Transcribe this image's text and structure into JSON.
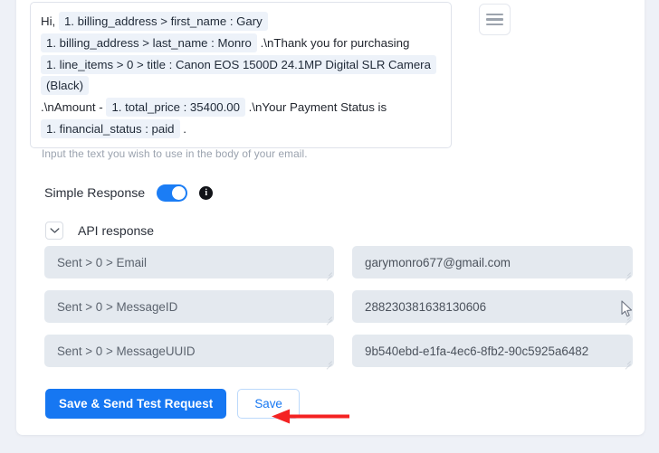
{
  "editor": {
    "lines": [
      [
        {
          "type": "text",
          "value": "Hi, "
        },
        {
          "type": "chip",
          "value": "1. billing_address > first_name : Gary"
        }
      ],
      [
        {
          "type": "chip",
          "value": "1. billing_address > last_name : Monro"
        },
        {
          "type": "text",
          "value": " .\\nThank you for purchasing"
        }
      ],
      [
        {
          "type": "chip",
          "value": "1. line_items > 0 > title : Canon EOS 1500D 24.1MP Digital SLR Camera (Black)"
        }
      ],
      [
        {
          "type": "text",
          "value": ".\\nAmount - "
        },
        {
          "type": "chip",
          "value": "1. total_price : 35400.00"
        },
        {
          "type": "text",
          "value": " .\\nYour Payment Status is"
        }
      ],
      [
        {
          "type": "chip",
          "value": "1. financial_status : paid"
        },
        {
          "type": "text",
          "value": " ."
        }
      ]
    ],
    "helper_text": "Input the text you wish to use in the body of your email.",
    "menu_icon": "hamburger-menu-icon"
  },
  "simple_response": {
    "label": "Simple Response",
    "toggle_state": "on",
    "toggle_color": "#1b7df5",
    "info_icon": "info-icon"
  },
  "api_response": {
    "label": "API response",
    "chevron_icon": "chevron-down-icon",
    "expanded": true,
    "fields": [
      {
        "key": "Sent > 0 > Email",
        "value": "garymonro677@gmail.com"
      },
      {
        "key": "Sent > 0 > MessageID",
        "value": "288230381638130606"
      },
      {
        "key": "Sent > 0 > MessageUUID",
        "value": "9b540ebd-e1fa-4ec6-8fb2-90c5925a6482"
      }
    ]
  },
  "buttons": {
    "primary_label": "Save & Send Test Request",
    "primary_color": "#1677f2",
    "secondary_label": "Save",
    "secondary_color": "#1677f2"
  },
  "annotation": {
    "arrow_color": "#f42222",
    "arrow_direction": "left",
    "points_to": "Save"
  },
  "cursor": {
    "icon": "mouse-pointer-icon"
  }
}
